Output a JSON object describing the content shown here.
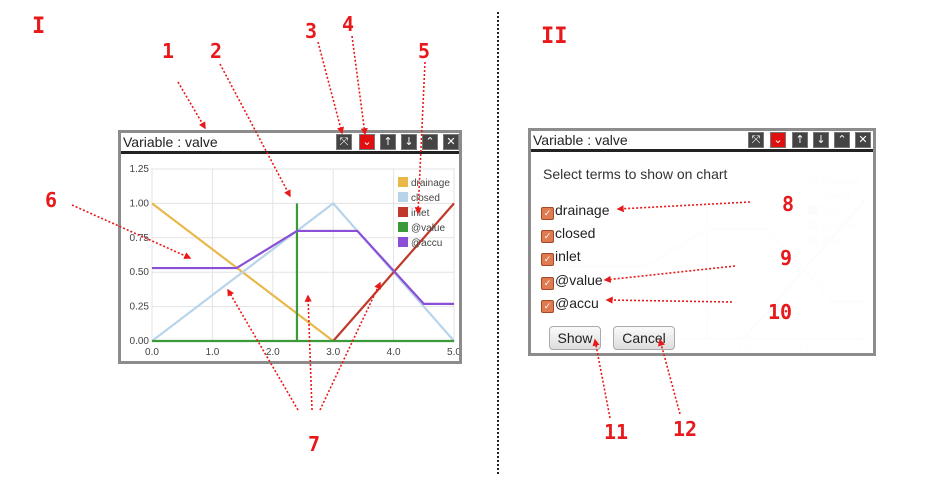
{
  "panels": [
    {
      "roman": "I"
    },
    {
      "roman": "II"
    }
  ],
  "window": {
    "title": "Variable : valve",
    "buttons": [
      {
        "name": "maximize",
        "icon": "expand-arrows-icon"
      },
      {
        "name": "dropdown",
        "icon": "chevron-down-icon",
        "color": "#e01010"
      },
      {
        "name": "move-up",
        "icon": "arrow-up-icon"
      },
      {
        "name": "move-down",
        "icon": "arrow-down-icon"
      },
      {
        "name": "collapse",
        "icon": "chevron-up-icon"
      },
      {
        "name": "close",
        "icon": "close-x-icon"
      }
    ]
  },
  "chart_data": {
    "type": "line",
    "x_ticks": [
      "0.0",
      "1.0",
      "2.0",
      "3.0",
      "4.0",
      "5.0"
    ],
    "y_ticks": [
      "0.00",
      "0.25",
      "0.50",
      "0.75",
      "1.00",
      "1.25"
    ],
    "xlim": [
      0,
      5
    ],
    "ylim": [
      0,
      1.25
    ],
    "grid": true,
    "legend_position": "top-right",
    "series": [
      {
        "name": "drainage",
        "color": "#e8b84a",
        "points": [
          [
            0,
            1
          ],
          [
            3,
            0
          ]
        ]
      },
      {
        "name": "closed",
        "color": "#b8d4ea",
        "points": [
          [
            0,
            0
          ],
          [
            3,
            1
          ],
          [
            5,
            0
          ]
        ]
      },
      {
        "name": "inlet",
        "color": "#c0392b",
        "points": [
          [
            3,
            0
          ],
          [
            5,
            1
          ]
        ]
      },
      {
        "name": "@value",
        "color": "#3a9a3a",
        "points": [
          [
            0,
            0
          ],
          [
            2.4,
            0
          ],
          [
            2.4,
            1
          ],
          [
            2.4,
            0
          ],
          [
            5,
            0
          ]
        ]
      },
      {
        "name": "@accu",
        "color": "#8a4fd6",
        "points": [
          [
            0,
            0.53
          ],
          [
            1.4,
            0.53
          ],
          [
            2.4,
            0.8
          ],
          [
            3.4,
            0.8
          ],
          [
            4.5,
            0.27
          ],
          [
            5,
            0.27
          ]
        ]
      }
    ]
  },
  "dialog": {
    "title": "Select terms to show on chart",
    "terms": [
      {
        "label": "drainage",
        "checked": true
      },
      {
        "label": "closed",
        "checked": true
      },
      {
        "label": "inlet",
        "checked": true
      },
      {
        "label": "@value",
        "checked": true
      },
      {
        "label": "@accu",
        "checked": true
      }
    ],
    "show_label": "Show",
    "cancel_label": "Cancel"
  },
  "callouts": [
    "1",
    "2",
    "3",
    "4",
    "5",
    "6",
    "7",
    "8",
    "9",
    "10",
    "11",
    "12"
  ],
  "colors": {
    "annotation": "#e8191a",
    "checkbox": "#e07a50",
    "active_button": "#e01010"
  }
}
